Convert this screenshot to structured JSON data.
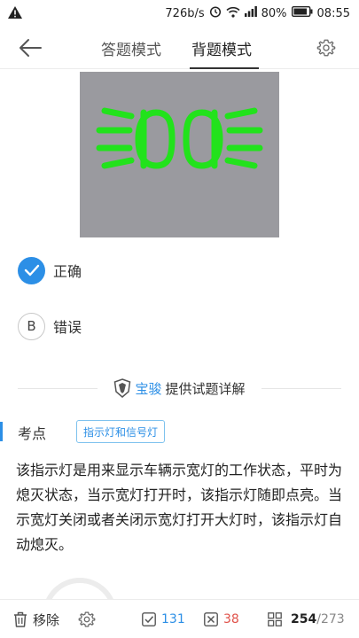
{
  "status_bar": {
    "speed": "726b/s",
    "battery": "80%",
    "time": "08:55"
  },
  "header": {
    "tabs": [
      {
        "label": "答题模式"
      },
      {
        "label": "背题模式"
      }
    ]
  },
  "question_image": {
    "icon": "headlight-icon",
    "colors": {
      "background": "#9a9a9f",
      "symbol": "#22e21c"
    }
  },
  "options": [
    {
      "marker": "✓",
      "text": "正确",
      "selected": true
    },
    {
      "marker": "B",
      "text": "错误",
      "selected": false
    }
  ],
  "sponsor": {
    "brand": "宝骏",
    "suffix": "提供试题详解"
  },
  "knowledge_point": {
    "label": "考点",
    "tag": "指示灯和信号灯"
  },
  "explanation": "该指示灯是用来显示车辆示宽灯的工作状态，平时为熄灭状态，当示宽灯打开时，该指示灯随即点亮。当示宽灯关闭或者关闭示宽灯打开大灯时，该指示灯自动熄灭。",
  "bottom_bar": {
    "remove_label": "移除",
    "correct_count": "131",
    "wrong_count": "38",
    "current": "254",
    "total": "/273"
  },
  "colors": {
    "accent": "#2c8fe6",
    "wrong": "#e0524a"
  }
}
